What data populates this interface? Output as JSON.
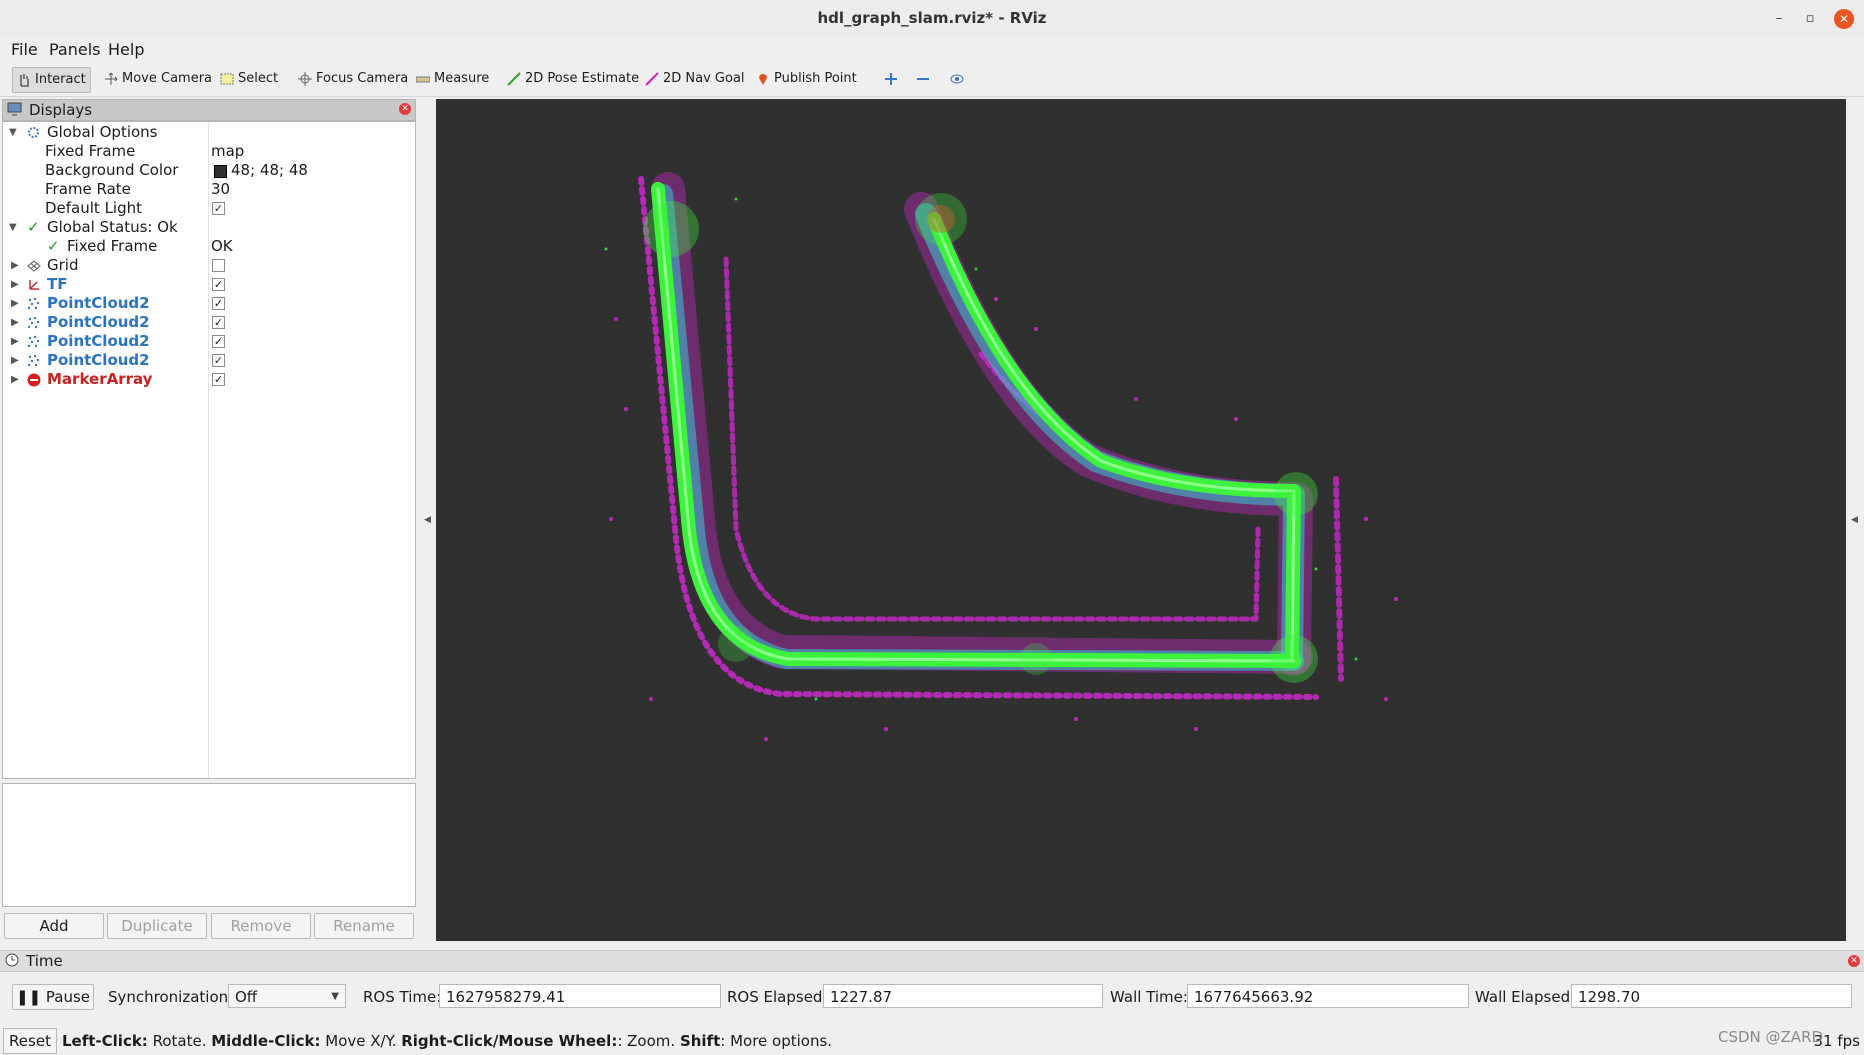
{
  "window": {
    "title": "hdl_graph_slam.rviz* - RViz"
  },
  "menu": {
    "file": "File",
    "panels": "Panels",
    "help": "Help"
  },
  "toolbar": {
    "interact": "Interact",
    "move_camera": "Move Camera",
    "select": "Select",
    "focus_camera": "Focus Camera",
    "measure": "Measure",
    "pose_estimate": "2D Pose Estimate",
    "nav_goal": "2D Nav Goal",
    "publish_point": "Publish Point"
  },
  "displays": {
    "title": "Displays",
    "global_options": {
      "label": "Global Options",
      "fixed_frame_label": "Fixed Frame",
      "fixed_frame_value": "map",
      "bg_color_label": "Background Color",
      "bg_color_value": "48; 48; 48",
      "bg_color_hex": "#303030",
      "frame_rate_label": "Frame Rate",
      "frame_rate_value": "30",
      "default_light_label": "Default Light",
      "default_light_checked": true
    },
    "global_status": {
      "label": "Global Status: Ok",
      "fixed_frame_label": "Fixed Frame",
      "fixed_frame_value": "OK"
    },
    "items": [
      {
        "label": "Grid",
        "checked": false,
        "icon": "grid-icon"
      },
      {
        "label": "TF",
        "checked": true,
        "icon": "tf-icon"
      },
      {
        "label": "PointCloud2",
        "checked": true,
        "icon": "pointcloud-icon"
      },
      {
        "label": "PointCloud2",
        "checked": true,
        "icon": "pointcloud-icon"
      },
      {
        "label": "PointCloud2",
        "checked": true,
        "icon": "pointcloud-icon"
      },
      {
        "label": "PointCloud2",
        "checked": true,
        "icon": "pointcloud-icon"
      },
      {
        "label": "MarkerArray",
        "checked": true,
        "icon": "error-icon"
      }
    ],
    "buttons": {
      "add": "Add",
      "duplicate": "Duplicate",
      "remove": "Remove",
      "rename": "Rename"
    }
  },
  "time": {
    "title": "Time",
    "pause": "Pause",
    "sync_label": "Synchronization:",
    "sync_value": "Off",
    "ros_time_label": "ROS Time:",
    "ros_time": "1627958279.41",
    "ros_elapsed_label": "ROS Elapsed:",
    "ros_elapsed": "1227.87",
    "wall_time_label": "Wall Time:",
    "wall_time": "1677645663.92",
    "wall_elapsed_label": "Wall Elapsed:",
    "wall_elapsed": "1298.70"
  },
  "status": {
    "reset": "Reset",
    "lc_key": "Left-Click:",
    "lc_text": " Rotate. ",
    "mc_key": "Middle-Click:",
    "mc_text": " Move X/Y. ",
    "rc_key": "Right-Click/Mouse Wheel:",
    "rc_text": ": Zoom. ",
    "shift_key": "Shift",
    "shift_text": ": More options.",
    "fps": "31 fps",
    "watermark": "CSDN @ZARD"
  },
  "colors": {
    "accent": "#2a73c4",
    "error": "#d02020",
    "cloud_green": "#3cf23c",
    "cloud_magenta": "#e028e0",
    "cloud_cyan": "#38c8d8"
  }
}
